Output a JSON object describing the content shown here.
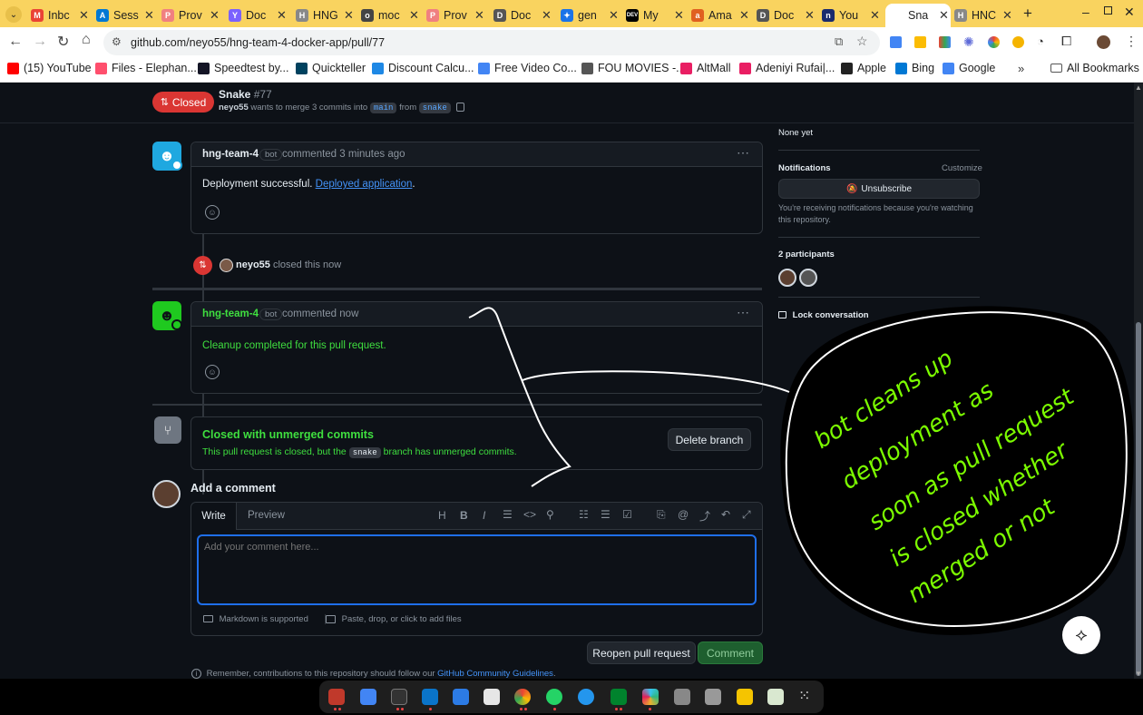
{
  "browser": {
    "tabs": [
      {
        "label": "Inbc",
        "fav": "#ea4335",
        "glyph": "M"
      },
      {
        "label": "Sess",
        "fav": "#0078d4",
        "glyph": "A"
      },
      {
        "label": "Prov",
        "fav": "#f08080",
        "glyph": "P"
      },
      {
        "label": "Doc",
        "fav": "#7b61ff",
        "glyph": "Y"
      },
      {
        "label": "HNG",
        "fav": "#888888",
        "glyph": "H"
      },
      {
        "label": "moc",
        "fav": "#444444",
        "glyph": "o"
      },
      {
        "label": "Prov",
        "fav": "#f08080",
        "glyph": "P"
      },
      {
        "label": "Doc",
        "fav": "#555555",
        "glyph": "D"
      },
      {
        "label": "gen",
        "fav": "#1a73e8",
        "glyph": "✦"
      },
      {
        "label": "My",
        "fav": "#000000",
        "glyph": "DEV"
      },
      {
        "label": "Ama",
        "fav": "#e06020",
        "glyph": "a"
      },
      {
        "label": "Doc",
        "fav": "#555555",
        "glyph": "D"
      },
      {
        "label": "You",
        "fav": "#1a2b6d",
        "glyph": "n"
      },
      {
        "label": "Sna",
        "fav": "#ffffff",
        "glyph": ""
      },
      {
        "label": "HNC",
        "fav": "#888888",
        "glyph": "H"
      }
    ],
    "active_tab_index": 13,
    "url": "github.com/neyo55/hng-team-4-docker-app/pull/77",
    "bookmarks": [
      {
        "label": "(15) YouTube",
        "color": "#ff0000"
      },
      {
        "label": "Files - Elephan...",
        "color": "#ff4f6d"
      },
      {
        "label": "Speedtest by...",
        "color": "#141526"
      },
      {
        "label": "Quickteller",
        "color": "#00425f"
      },
      {
        "label": "Discount Calcu...",
        "color": "#1e88e5"
      },
      {
        "label": "Free Video Co...",
        "color": "#4285f4"
      },
      {
        "label": "FOU MOVIES -...",
        "color": "#555555"
      },
      {
        "label": "AltMall",
        "color": "#e91e63"
      },
      {
        "label": "Adeniyi Rufai|...",
        "color": "#e91e63"
      },
      {
        "label": "Apple",
        "color": "#222222"
      },
      {
        "label": "Bing",
        "color": "#0078d4"
      },
      {
        "label": "Google",
        "color": "#4285f4"
      }
    ],
    "all_bookmarks": "All Bookmarks"
  },
  "pr": {
    "state": "Closed",
    "title": "Snake",
    "number": "#77",
    "author": "neyo55",
    "merge_text": "wants to merge 3 commits into",
    "base_branch": "main",
    "from_text": "from",
    "head_branch": "snake"
  },
  "comments": [
    {
      "author": "hng-team-4",
      "badge": "bot",
      "meta": "commented 3 minutes ago",
      "text": "Deployment successful. ",
      "link": "Deployed application",
      "tail": "."
    },
    {
      "author": "hng-team-4",
      "badge": "bot",
      "meta": "commented now",
      "text": "Cleanup completed for this pull request."
    }
  ],
  "event": {
    "user": "neyo55",
    "action": "closed this now"
  },
  "unmerged": {
    "title": "Closed with unmerged commits",
    "text_before": "This pull request is closed, but the",
    "branch": "snake",
    "text_after": "branch has unmerged commits.",
    "delete_button": "Delete branch"
  },
  "add_comment": {
    "heading": "Add a comment",
    "tab_write": "Write",
    "tab_preview": "Preview",
    "placeholder": "Add your comment here...",
    "markdown_note": "Markdown is supported",
    "attach_note": "Paste, drop, or click to add files",
    "reopen_button": "Reopen pull request",
    "comment_button": "Comment",
    "guidelines_before": "Remember, contributions to this repository should follow our",
    "guidelines_link": "GitHub Community Guidelines",
    "guidelines_after": "."
  },
  "sidebar": {
    "milestone_value": "None yet",
    "notifications_label": "Notifications",
    "customize_label": "Customize",
    "unsubscribe_button": "Unsubscribe",
    "notifications_note": "You're receiving notifications because you're watching this repository.",
    "participants_label": "2 participants",
    "lock_label": "Lock conversation"
  },
  "annotation": {
    "lines": [
      "bot cleans up",
      "deployment as",
      "soon as pull request",
      "is closed whether",
      "merged or not"
    ],
    "ink_color": "#7cfc00"
  },
  "colors": {
    "green": "#3fb950",
    "red": "#da3633",
    "blue": "#4493f8",
    "tab_strip": "#f9d35f"
  }
}
